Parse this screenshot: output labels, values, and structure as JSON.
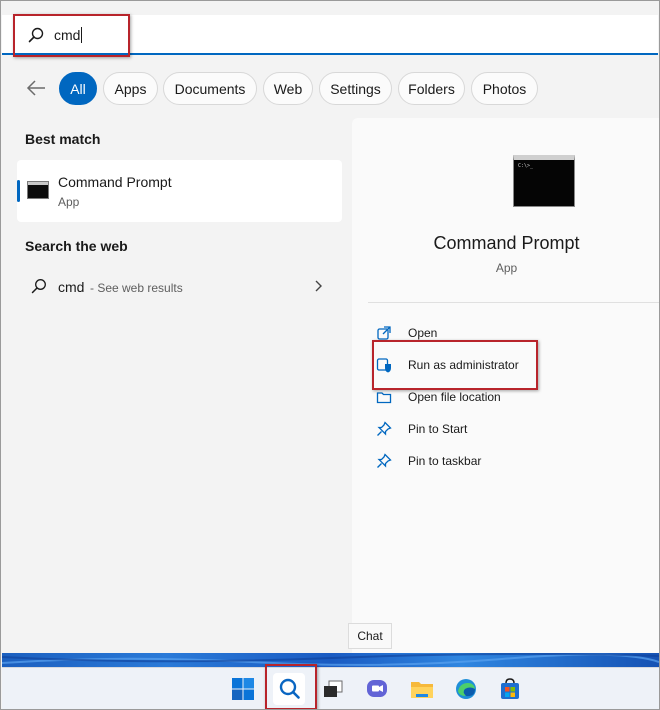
{
  "search": {
    "query": "cmd"
  },
  "filters": [
    "All",
    "Apps",
    "Documents",
    "Web",
    "Settings",
    "Folders",
    "Photos"
  ],
  "active_filter": "All",
  "left": {
    "best_match_title": "Best match",
    "best_match": {
      "name": "Command Prompt",
      "type": "App"
    },
    "web_title": "Search the web",
    "web_result": {
      "query": "cmd",
      "suffix": "- See web results"
    }
  },
  "right": {
    "app_name": "Command Prompt",
    "app_type": "App",
    "actions": [
      {
        "label": "Open",
        "icon": "open-icon"
      },
      {
        "label": "Run as administrator",
        "icon": "shield-icon"
      },
      {
        "label": "Open file location",
        "icon": "folder-icon"
      },
      {
        "label": "Pin to Start",
        "icon": "pin-icon"
      },
      {
        "label": "Pin to taskbar",
        "icon": "pin-icon"
      }
    ]
  },
  "tooltip": "Chat",
  "taskbar": {
    "icons": [
      "windows-start-icon",
      "search-icon",
      "task-view-icon",
      "chat-icon",
      "file-explorer-icon",
      "edge-icon",
      "store-icon"
    ]
  },
  "colors": {
    "accent": "#0067c0",
    "highlight": "#b8242b"
  }
}
